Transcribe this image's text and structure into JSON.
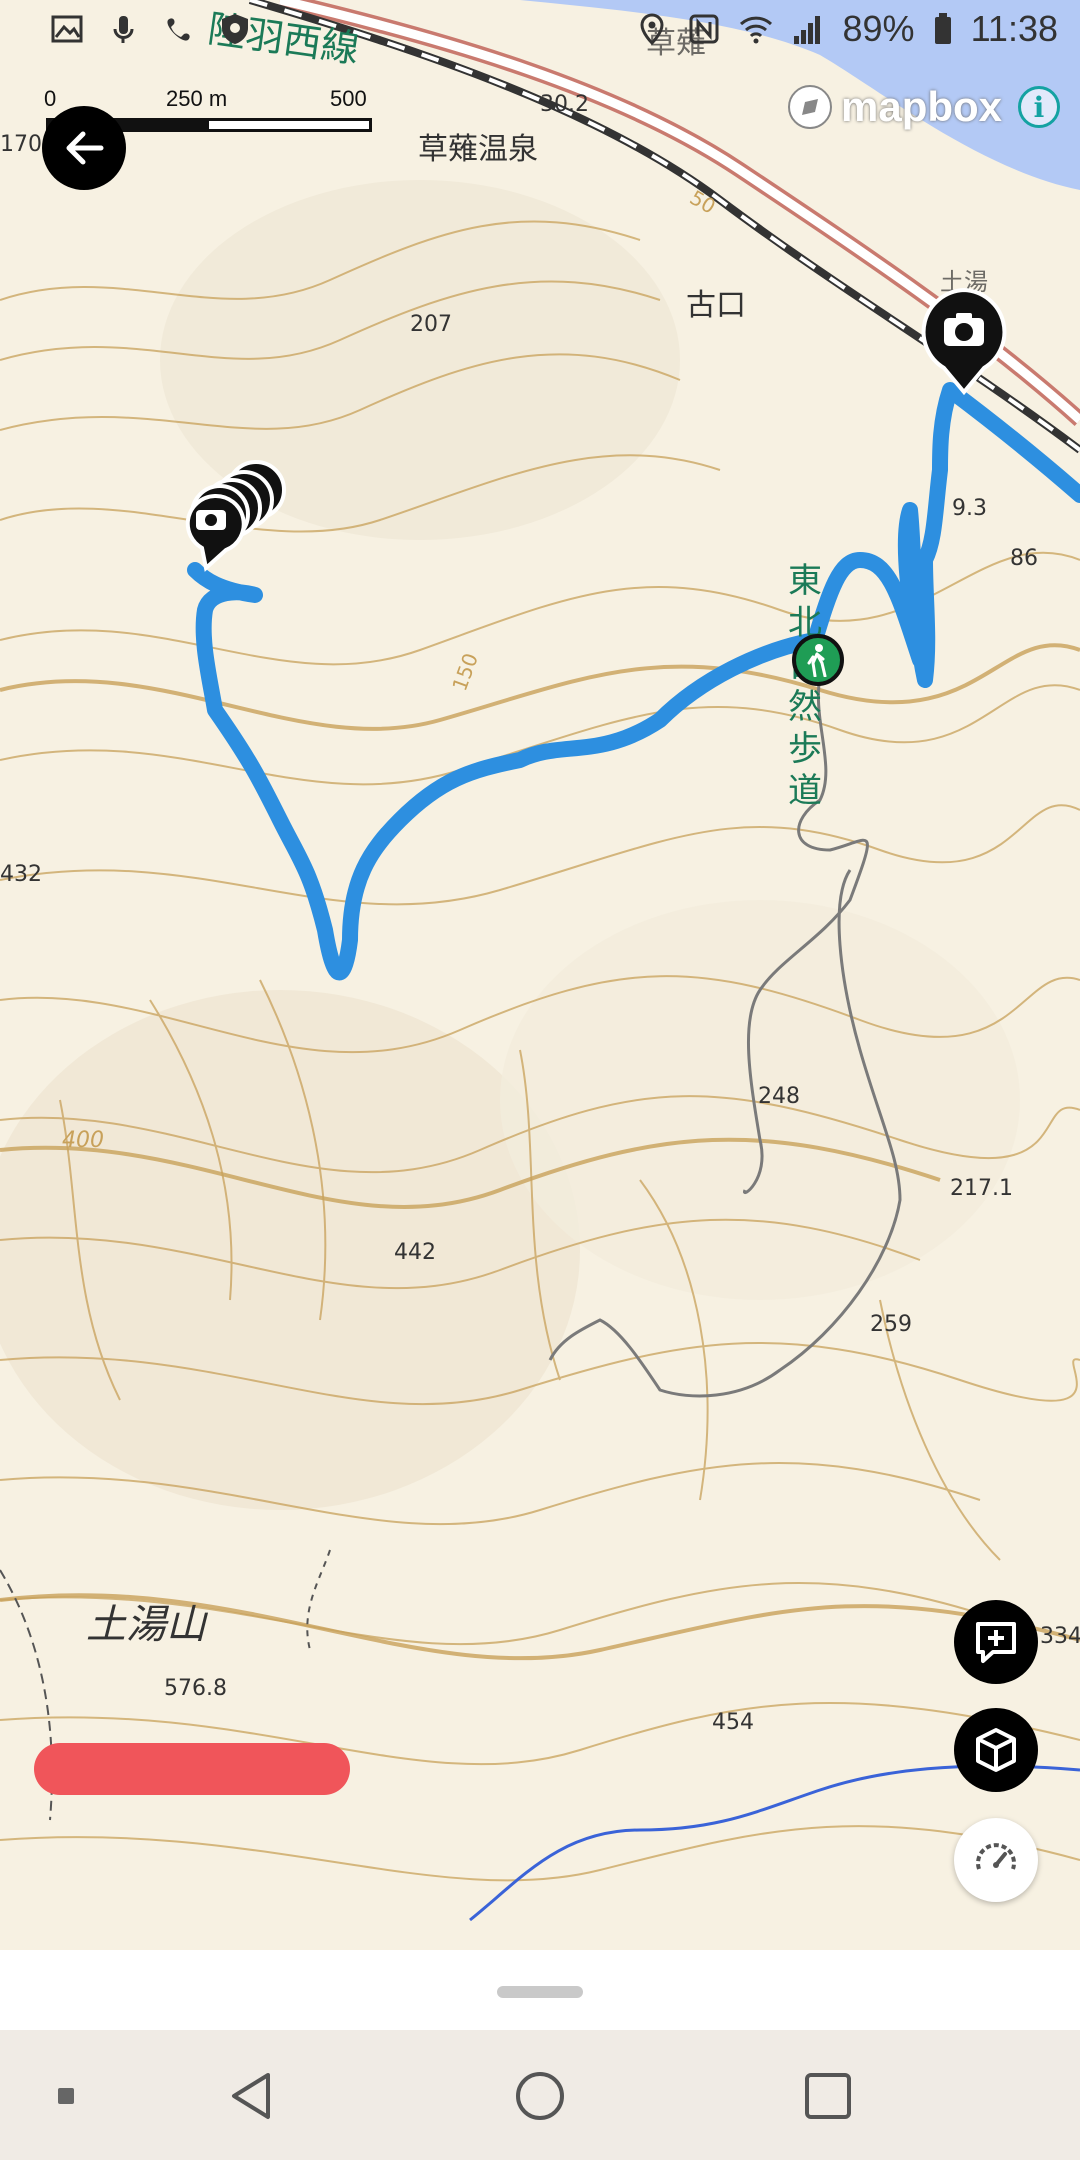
{
  "status_bar": {
    "battery_percent": "89%",
    "time": "11:38",
    "left_icons": [
      "gallery-icon",
      "voicemail-icon",
      "wifi-calling-icon",
      "shield-icon"
    ],
    "right_icons": [
      "location-icon",
      "nfc-icon",
      "wifi-icon",
      "signal-icon",
      "battery-icon"
    ]
  },
  "scale_bar": {
    "labels": [
      "0",
      "250 m",
      "500 m"
    ]
  },
  "attribution": {
    "logo_text": "mapbox",
    "info_label": "i"
  },
  "map": {
    "labels": {
      "rail_line": "陸羽西線",
      "station": "草薙温泉",
      "station_top": "草薙",
      "area": "古口",
      "trail_name": [
        "東",
        "北",
        "自",
        "然",
        "歩",
        "道"
      ],
      "mountain": "土湯山",
      "tsuchiyu_top": "土湯",
      "elev_30_2": "30.2",
      "elev_207": "207",
      "elev_432": "432",
      "elev_170": "170",
      "elev_9_3": "9.3",
      "elev_86": "86",
      "elev_248": "248",
      "elev_217_1": "217.1",
      "elev_442": "442",
      "elev_259": "259",
      "elev_576_8": "576.8",
      "elev_454": "454",
      "elev_334": "334",
      "contour_400": "400",
      "contour_150": "150",
      "contour_50": "50"
    },
    "colors": {
      "track": "#2d8fe0",
      "water": "#b3c9f5",
      "contour": "#c8a15a",
      "trail": "#7a7a7a",
      "hiker": "#1f9d55"
    },
    "markers": [
      "photo-marker-cluster",
      "photo-marker-riverside",
      "hiker-marker"
    ]
  },
  "controls": [
    "add-waypoint-button",
    "3d-view-button",
    "speedometer-button"
  ],
  "navigation_bar": [
    "recent-apps-dot",
    "back-button",
    "home-button",
    "overview-button"
  ]
}
